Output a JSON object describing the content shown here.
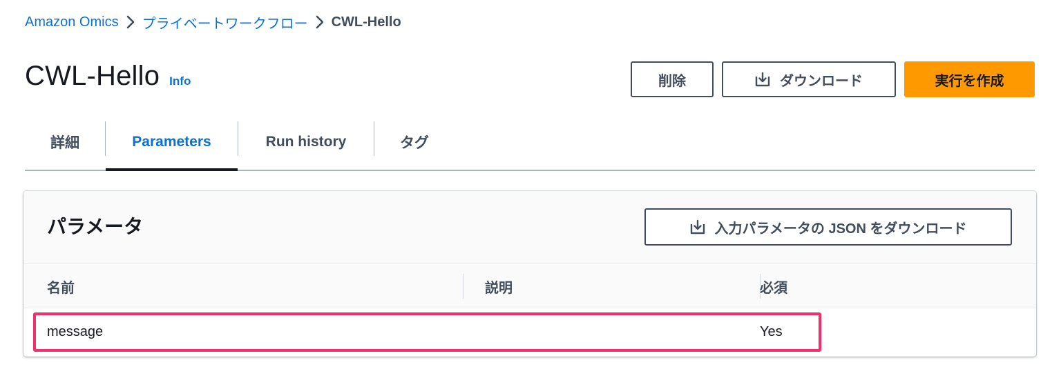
{
  "breadcrumb": {
    "items": [
      "Amazon Omics",
      "プライベートワークフロー"
    ],
    "current": "CWL-Hello"
  },
  "header": {
    "title": "CWL-Hello",
    "info_label": "Info",
    "delete_label": "削除",
    "download_label": "ダウンロード",
    "create_run_label": "実行を作成"
  },
  "tabs": [
    {
      "label": "詳細",
      "active": false
    },
    {
      "label": "Parameters",
      "active": true
    },
    {
      "label": "Run history",
      "active": false
    },
    {
      "label": "タグ",
      "active": false
    }
  ],
  "parameters": {
    "title": "パラメータ",
    "download_json_label": "入力パラメータの JSON をダウンロード",
    "columns": [
      "名前",
      "説明",
      "必須"
    ],
    "rows": [
      {
        "name": "message",
        "description": "",
        "required": "Yes"
      }
    ]
  },
  "colors": {
    "link": "#0972d3",
    "primary_button": "#ff9900",
    "highlight_border": "#f0306d",
    "text": "#16191f",
    "secondary_text": "#414d5c"
  },
  "icons": {
    "breadcrumb_separator": "chevron-right-icon",
    "download": "download-icon"
  }
}
